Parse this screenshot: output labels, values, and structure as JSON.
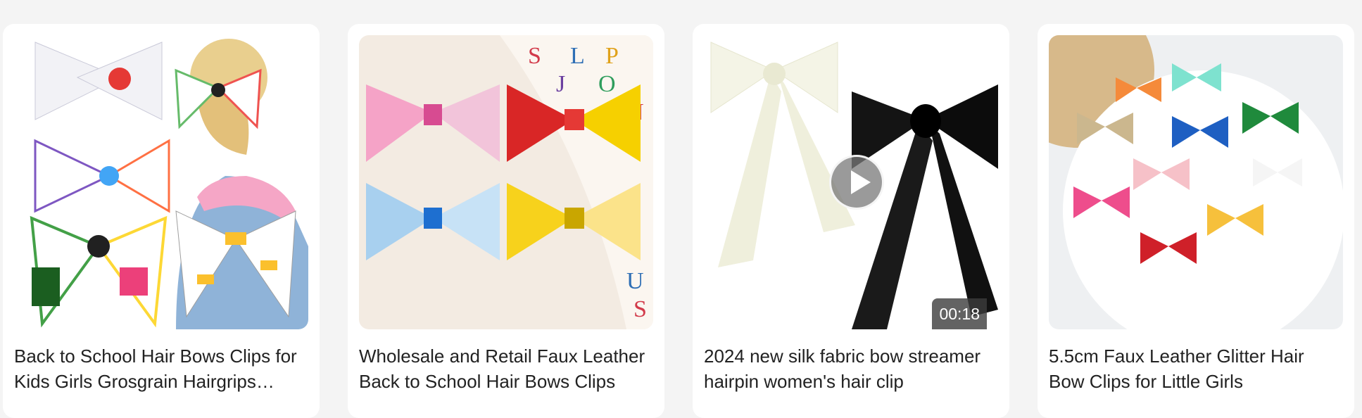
{
  "products": [
    {
      "title": "Back to School Hair Bows Clips for Kids Girls Grosgrain Hairgrips Cheer Bows",
      "image_icon": "school-hair-bows-image"
    },
    {
      "title": "Wholesale and Retail Faux Leather Back to School Hair Bows Clips",
      "image_icon": "faux-leather-bows-image"
    },
    {
      "title": "2024 new silk fabric bow streamer hairpin women's hair clip",
      "image_icon": "silk-bow-image",
      "video_duration": "00:18"
    },
    {
      "title": "5.5cm Faux Leather Glitter Hair Bow Clips for Little Girls",
      "image_icon": "glitter-bows-image"
    }
  ]
}
